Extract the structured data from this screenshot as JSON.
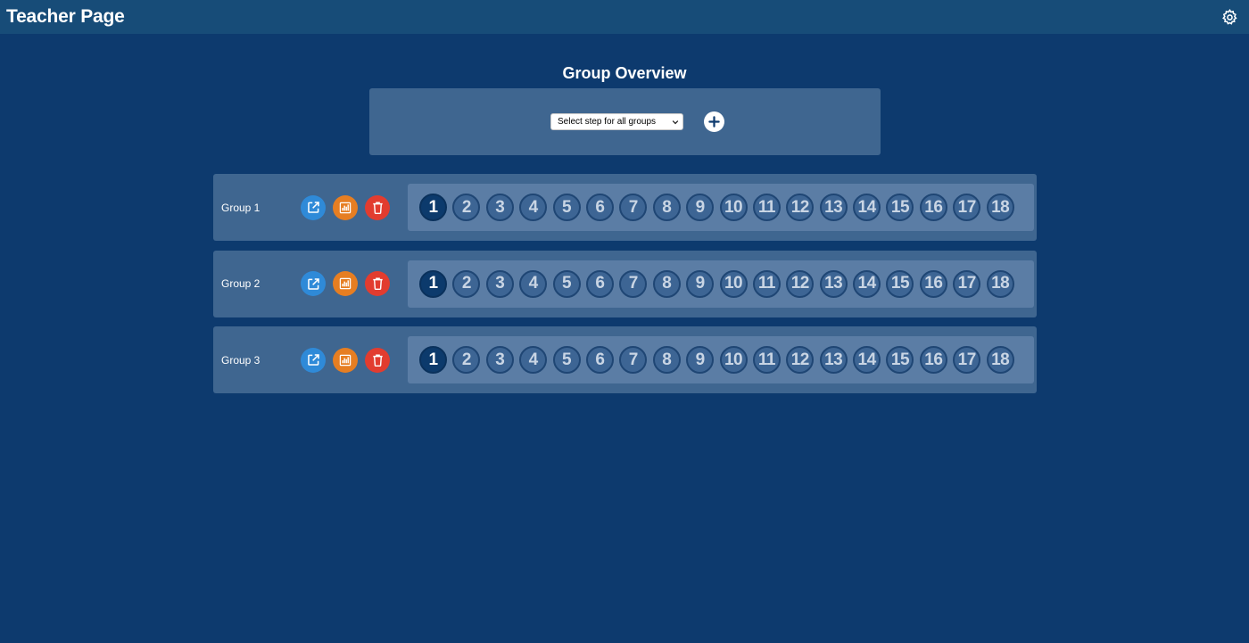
{
  "header": {
    "title": "Teacher Page",
    "settings_icon": "gear-icon"
  },
  "main": {
    "heading": "Group Overview",
    "step_select": {
      "selected": "Select step for all groups"
    },
    "add_button_icon": "plus-icon"
  },
  "groups": [
    {
      "name": "Group 1",
      "active_step": 1
    },
    {
      "name": "Group 2",
      "active_step": 1
    },
    {
      "name": "Group 3",
      "active_step": 1
    }
  ],
  "steps": [
    "1",
    "2",
    "3",
    "4",
    "5",
    "6",
    "7",
    "8",
    "9",
    "10",
    "11",
    "12",
    "13",
    "14",
    "15",
    "16",
    "17",
    "18"
  ],
  "colors": {
    "background": "#0d3a6e",
    "topbar": "#174c78",
    "panel": "#3f6690",
    "edit": "#2f8ad8",
    "stats": "#e67e22",
    "delete": "#e23c2f",
    "active_step": "#0c3a6c"
  }
}
